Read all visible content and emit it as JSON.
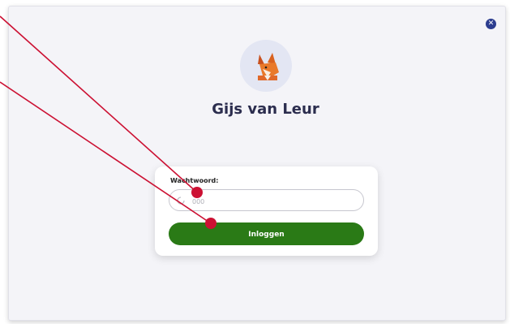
{
  "user": {
    "name": "Gijs van Leur",
    "avatar_icon": "fox-icon"
  },
  "login": {
    "password_label": "Wachtwoord:",
    "password_placeholder": "000",
    "submit_label": "Inloggen"
  },
  "close_icon": "close-icon",
  "colors": {
    "accent": "#2c3d8f",
    "button": "#2a7a16",
    "annotation": "#cc1133",
    "title": "#2b2d4e"
  }
}
